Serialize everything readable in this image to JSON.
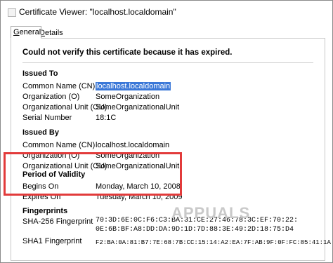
{
  "window": {
    "title": "Certificate Viewer: \"localhost.localdomain\""
  },
  "tabs": [
    {
      "label": "General",
      "active": true
    },
    {
      "label": "Details",
      "active": false
    }
  ],
  "error_message": "Could not verify this certificate because it has expired.",
  "issued_to": {
    "heading": "Issued To",
    "rows": [
      {
        "label": "Common Name (CN)",
        "value": "localhost.localdomain"
      },
      {
        "label": "Organization (O)",
        "value": "SomeOrganization"
      },
      {
        "label": "Organizational Unit (OU)",
        "value": "SomeOrganizationalUnit"
      },
      {
        "label": "Serial Number",
        "value": "18:1C"
      }
    ]
  },
  "issued_by": {
    "heading": "Issued By",
    "rows": [
      {
        "label": "Common Name (CN)",
        "value": "localhost.localdomain"
      },
      {
        "label": "Organization (O)",
        "value": "SomeOrganization"
      },
      {
        "label": "Organizational Unit (OU)",
        "value": "SomeOrganizationalUnit"
      }
    ]
  },
  "validity": {
    "heading": "Period of Validity",
    "rows": [
      {
        "label": "Begins On",
        "value": "Monday, March 10, 2008"
      },
      {
        "label": "Expires On",
        "value": "Tuesday, March 10, 2009"
      }
    ]
  },
  "fingerprints": {
    "heading": "Fingerprints",
    "sha256_label": "SHA-256 Fingerprint",
    "sha256_line1": "70:3D:6E:0C:F6:C3:BA:31:CE:27:46:78:3C:EF:70:22:",
    "sha256_line2": "0E:6B:BF:A8:DD:DA:9D:1D:7D:88:3E:49:2D:18:75:D4",
    "sha1_label": "SHA1 Fingerprint",
    "sha1_value": "F2:BA:0A:81:B7:7E:68:7B:CC:15:14:A2:EA:7F:AB:9F:0F:FC:85:41:1A"
  },
  "watermark": "APPUALS",
  "colors": {
    "highlight_border": "#e23b3b",
    "selection": "#3b78d8"
  }
}
